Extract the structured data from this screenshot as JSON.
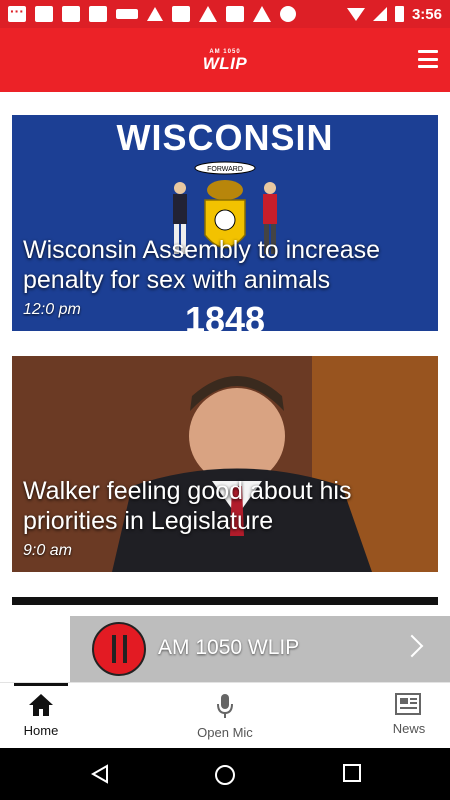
{
  "status_bar": {
    "time": "3:56"
  },
  "header": {
    "logo_small": "AM 1050",
    "logo_main": "WLIP"
  },
  "feed": {
    "articles": [
      {
        "headline": "Wisconsin Assembly to increase penalty for sex with animals",
        "time": "12:0 pm",
        "image_text_top": "WISCONSIN",
        "image_text_bottom": "1848",
        "image_banner": "FORWARD"
      },
      {
        "headline": "Walker feeling good about his priorities in Legislature",
        "time": "9:0 am"
      }
    ]
  },
  "player": {
    "station": "AM 1050 WLIP"
  },
  "bottom_nav": {
    "items": [
      {
        "label": "Home",
        "icon": "home-icon"
      },
      {
        "label": "Open Mic",
        "icon": "microphone-icon"
      },
      {
        "label": "News",
        "icon": "newspaper-icon"
      }
    ]
  },
  "colors": {
    "status_bar": "#dd1f26",
    "header": "#ec2227",
    "flag_blue": "#1c3f94",
    "player_bg": "#bdbdbd",
    "pause_button": "#e31b23"
  }
}
